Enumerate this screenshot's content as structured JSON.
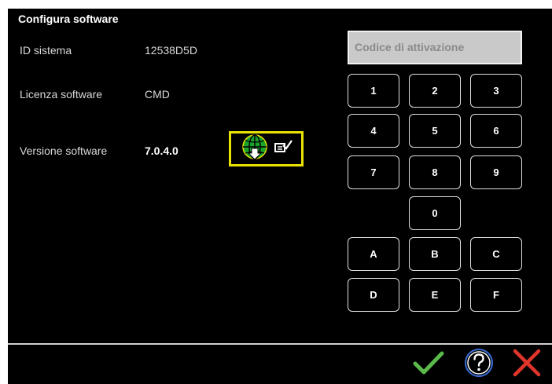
{
  "header": {
    "title": "Configura software"
  },
  "info": {
    "system_id_label": "ID sistema",
    "system_id_value": "12538D5D",
    "license_label": "Licenza software",
    "license_value": "CMD",
    "version_label": "Versione software",
    "version_value": "7.0.4.0"
  },
  "update_button": {
    "icons": [
      "globe-download-icon",
      "checklist-icon"
    ],
    "accent": "#e8e400"
  },
  "activation": {
    "placeholder": "Codice di attivazione",
    "keys": [
      "1",
      "2",
      "3",
      "4",
      "5",
      "6",
      "7",
      "8",
      "9",
      "0",
      "A",
      "B",
      "C",
      "D",
      "E",
      "F"
    ]
  },
  "footer": {
    "icons": [
      "confirm-check-icon",
      "help-icon",
      "cancel-icon"
    ],
    "colors": {
      "confirm": "#5ab94a",
      "help": "#3a6fd8",
      "cancel": "#e0352b"
    }
  }
}
